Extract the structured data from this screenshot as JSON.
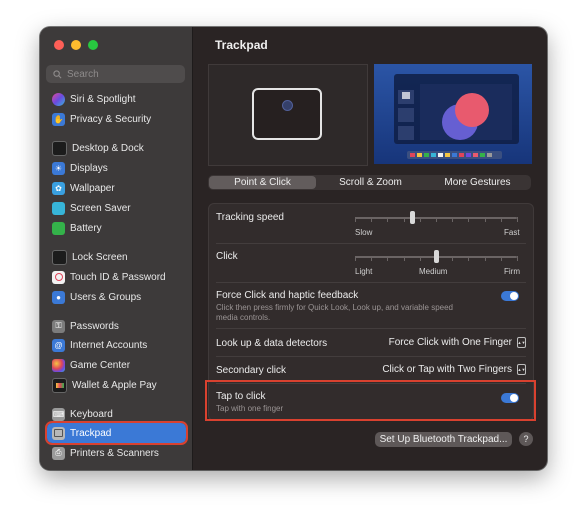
{
  "window": {
    "title": "Trackpad"
  },
  "search": {
    "placeholder": "Search"
  },
  "sidebar": {
    "items": [
      {
        "label": "Siri & Spotlight",
        "icon": "siri-icon",
        "color": "#8a4fd6"
      },
      {
        "label": "Privacy & Security",
        "icon": "hand-icon",
        "color": "#3b79d6"
      },
      {
        "label": "Desktop & Dock",
        "icon": "dock-icon",
        "color": "#1c1c1c"
      },
      {
        "label": "Displays",
        "icon": "display-icon",
        "color": "#3b79d6"
      },
      {
        "label": "Wallpaper",
        "icon": "wallpaper-icon",
        "color": "#3aa0e0"
      },
      {
        "label": "Screen Saver",
        "icon": "screensaver-icon",
        "color": "#37b5d8"
      },
      {
        "label": "Battery",
        "icon": "battery-icon",
        "color": "#34b24a"
      },
      {
        "label": "Lock Screen",
        "icon": "lock-icon",
        "color": "#1c1c1c"
      },
      {
        "label": "Touch ID & Password",
        "icon": "fingerprint-icon",
        "color": "#e0455a"
      },
      {
        "label": "Users & Groups",
        "icon": "users-icon",
        "color": "#3b79d6"
      },
      {
        "label": "Passwords",
        "icon": "key-icon",
        "color": "#7c7c7c"
      },
      {
        "label": "Internet Accounts",
        "icon": "at-icon",
        "color": "#3b79d6"
      },
      {
        "label": "Game Center",
        "icon": "game-center-icon",
        "color": "#e8e8e8"
      },
      {
        "label": "Wallet & Apple Pay",
        "icon": "wallet-icon",
        "color": "#1c1c1c"
      },
      {
        "label": "Keyboard",
        "icon": "keyboard-icon",
        "color": "#9a9a9a"
      },
      {
        "label": "Trackpad",
        "icon": "trackpad-icon",
        "color": "#9a9a9a",
        "selected": true
      },
      {
        "label": "Printers & Scanners",
        "icon": "printer-icon",
        "color": "#9a9a9a"
      }
    ]
  },
  "tabs": {
    "point_click": "Point & Click",
    "scroll_zoom": "Scroll & Zoom",
    "more_gestures": "More Gestures",
    "active": "Point & Click"
  },
  "settings": {
    "tracking_speed": {
      "label": "Tracking speed",
      "min_label": "Slow",
      "max_label": "Fast",
      "value_fraction": 0.35
    },
    "click": {
      "label": "Click",
      "left_label": "Light",
      "mid_label": "Medium",
      "right_label": "Firm",
      "value_fraction": 0.5
    },
    "force_click": {
      "label": "Force Click and haptic feedback",
      "description": "Click then press firmly for Quick Look, Look up, and variable speed media controls.",
      "enabled": true
    },
    "lookup": {
      "label": "Look up & data detectors",
      "value": "Force Click with One Finger"
    },
    "secondary_click": {
      "label": "Secondary click",
      "value": "Click or Tap with Two Fingers"
    },
    "tap_to_click": {
      "label": "Tap to click",
      "description": "Tap with one finger",
      "enabled": true
    }
  },
  "footer": {
    "bluetooth_button": "Set Up Bluetooth Trackpad...",
    "help": "?"
  },
  "colors": {
    "accent": "#3b79d6",
    "highlight_box": "#d9412f",
    "window_bg": "#2a2424",
    "sidebar_bg": "#3d3a3a"
  }
}
